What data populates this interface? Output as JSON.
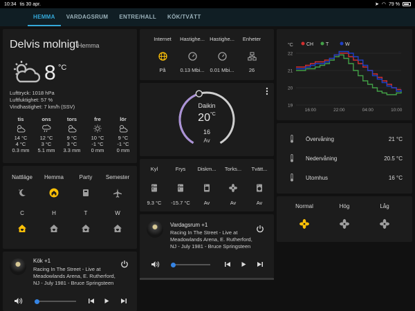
{
  "status": {
    "time": "10:34",
    "date": "tis 30 apr.",
    "battery": "79 %"
  },
  "tabs": [
    "HEMMA",
    "VARDAGSRUM",
    "ENTRE/HALL",
    "KÖK/TVÄTT"
  ],
  "weather": {
    "condition": "Delvis molnigt",
    "location": "Hemma",
    "temp": "8",
    "unit": "°C",
    "details": [
      "Lufttryck: 1018 hPa",
      "Luftfuktighet: 57 %",
      "Vindhastighet: 7 km/h (SSV)"
    ],
    "forecast": [
      {
        "day": "tis",
        "icon": "partly-cloudy-icon",
        "high": "14 °C",
        "low": "4 °C",
        "precip": "0.3 mm"
      },
      {
        "day": "ons",
        "icon": "rain-cloud-icon",
        "high": "12 °C",
        "low": "3 °C",
        "precip": "5.1 mm"
      },
      {
        "day": "tors",
        "icon": "partly-cloudy-icon",
        "high": "9 °C",
        "low": "3 °C",
        "precip": "3.3 mm"
      },
      {
        "day": "fre",
        "icon": "sunny-icon",
        "high": "10 °C",
        "low": "-1 °C",
        "precip": "0 mm"
      },
      {
        "day": "lör",
        "icon": "partly-cloudy-icon",
        "high": "9 °C",
        "low": "-1 °C",
        "precip": "0 mm"
      }
    ]
  },
  "modes": {
    "headers": [
      "Nattläge",
      "Hemma",
      "Party",
      "Semester"
    ],
    "labels": [
      "C",
      "H",
      "T",
      "W"
    ],
    "accent": "#ffc107"
  },
  "media_left": {
    "title": "Kök +1",
    "track": "Racing In The Street - Live at Meadowlands Arena, E. Rutherford, NJ - July 1981 - Bruce Springsteen",
    "progress": 0.05
  },
  "media_center": {
    "title": "Vardagsrum +1",
    "track": "Racing In The Street - Live at Meadowlands Arena, E. Rutherford, NJ - July 1981 - Bruce Springsteen",
    "progress": 0.05
  },
  "network": [
    {
      "label": "Internet",
      "value": "På",
      "icon": "globe-icon"
    },
    {
      "label": "Hastighe...",
      "value": "0.13 Mbi...",
      "icon": "speedometer-icon"
    },
    {
      "label": "Hastighe...",
      "value": "0.01 Mbi...",
      "icon": "speedometer-icon"
    },
    {
      "label": "Enheter",
      "value": "26",
      "icon": "network-devices-icon"
    }
  ],
  "thermostat": {
    "name": "Daikin",
    "current": "20",
    "unit": "°C",
    "target": "16",
    "mode": "Av"
  },
  "sensors": [
    {
      "label": "Kyl",
      "value": "9.3 °C",
      "icon": "fridge-icon"
    },
    {
      "label": "Frys",
      "value": "-15.7 °C",
      "icon": "fridge-icon"
    },
    {
      "label": "Diskm...",
      "value": "Av",
      "icon": "dishwasher-icon"
    },
    {
      "label": "Torks...",
      "value": "Av",
      "icon": "fan-icon"
    },
    {
      "label": "Tvätt...",
      "value": "Av",
      "icon": "washing-machine-icon"
    }
  ],
  "chart_data": {
    "type": "line",
    "ylabel": "°C",
    "yticks": [
      19,
      20,
      21,
      22
    ],
    "ylim": [
      19,
      22.2
    ],
    "xticks": [
      "16:00",
      "22:00",
      "04:00",
      "10:00"
    ],
    "x": [
      "13:00",
      "14:00",
      "15:00",
      "16:00",
      "17:00",
      "18:00",
      "19:00",
      "20:00",
      "21:00",
      "22:00",
      "23:00",
      "00:00",
      "01:00",
      "02:00",
      "03:00",
      "04:00",
      "05:00",
      "06:00",
      "07:00",
      "08:00",
      "09:00",
      "10:00",
      "10:30"
    ],
    "series": [
      {
        "name": "CH",
        "color": "#d32f2f",
        "values": [
          21.2,
          21.2,
          21.3,
          21.4,
          21.5,
          21.5,
          21.6,
          21.7,
          21.9,
          22.0,
          22.0,
          21.8,
          21.6,
          21.4,
          21.2,
          21.0,
          20.8,
          20.6,
          20.4,
          20.2,
          20.0,
          19.9,
          19.9
        ]
      },
      {
        "name": "T",
        "color": "#43a047",
        "values": [
          21.0,
          21.0,
          21.1,
          21.1,
          21.2,
          21.3,
          21.4,
          21.6,
          21.8,
          21.9,
          21.7,
          21.4,
          21.0,
          20.7,
          20.4,
          20.2,
          20.0,
          19.8,
          19.7,
          19.6,
          19.6,
          19.7,
          19.8
        ]
      },
      {
        "name": "W",
        "color": "#1e40c8",
        "values": [
          21.1,
          21.1,
          21.2,
          21.3,
          21.4,
          21.4,
          21.5,
          21.7,
          21.9,
          22.1,
          22.1,
          22.0,
          21.8,
          21.6,
          21.3,
          21.0,
          20.7,
          20.5,
          20.3,
          20.1,
          20.0,
          19.8,
          19.9
        ]
      }
    ],
    "grid": true,
    "legend": "top-left"
  },
  "temperatures": [
    {
      "label": "Övervåning",
      "value": "21 °C"
    },
    {
      "label": "Nedervåning",
      "value": "20.5 °C"
    },
    {
      "label": "Utomhus",
      "value": "16 °C"
    }
  ],
  "fan_modes": [
    {
      "label": "Normal",
      "active": true
    },
    {
      "label": "Hög",
      "active": false
    },
    {
      "label": "Låg",
      "active": false
    }
  ]
}
